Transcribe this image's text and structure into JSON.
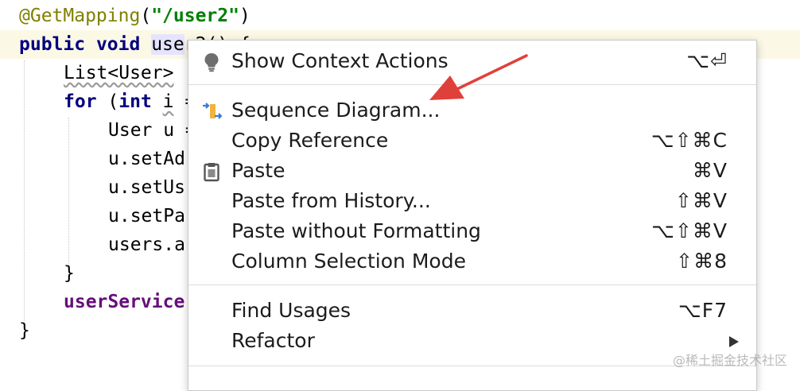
{
  "editor": {
    "line1": {
      "annotation": "@GetMapping",
      "open": "(",
      "string": "\"/user2\"",
      "close": ")"
    },
    "line2": {
      "kw1": "public",
      "kw2": "void",
      "ident": "use",
      "rest": "r2() {"
    },
    "line3": {
      "text": "List<User>"
    },
    "line4": {
      "kw": "for",
      "open": " (",
      "kw2": "int",
      "var": "i",
      "rest": " ="
    },
    "line5": {
      "text": "User u ="
    },
    "line6": {
      "text": "u.setAd"
    },
    "line7": {
      "text": "u.setUs"
    },
    "line8": {
      "text": "u.setPa"
    },
    "line9": {
      "text": "users.a"
    },
    "line10": {
      "text": "}"
    },
    "line11": {
      "field": "userService"
    },
    "line12": {
      "text": "}"
    }
  },
  "menu": {
    "items": [
      {
        "label": "Show Context Actions",
        "shortcut": "⌥⏎",
        "icon": "lightbulb-icon"
      },
      {
        "label": "Sequence Diagram...",
        "shortcut": "",
        "icon": "sequence-diagram-icon"
      },
      {
        "label": "Copy Reference",
        "shortcut": "⌥⇧⌘C",
        "icon": ""
      },
      {
        "label": "Paste",
        "shortcut": "⌘V",
        "icon": "clipboard-icon"
      },
      {
        "label": "Paste from History...",
        "shortcut": "⇧⌘V",
        "icon": ""
      },
      {
        "label": "Paste without Formatting",
        "shortcut": "⌥⇧⌘V",
        "icon": ""
      },
      {
        "label": "Column Selection Mode",
        "shortcut": "⇧⌘8",
        "icon": ""
      },
      {
        "label": "Find Usages",
        "shortcut": "⌥F7",
        "icon": ""
      },
      {
        "label": "Refactor",
        "shortcut": "",
        "icon": "chevron-right-icon"
      }
    ]
  },
  "watermark": "@稀土掘金技术社区",
  "colors": {
    "keyword": "#000080",
    "annotation": "#808000",
    "string": "#008000",
    "field": "#660e7a",
    "annotation_arrow": "#e0403a"
  }
}
